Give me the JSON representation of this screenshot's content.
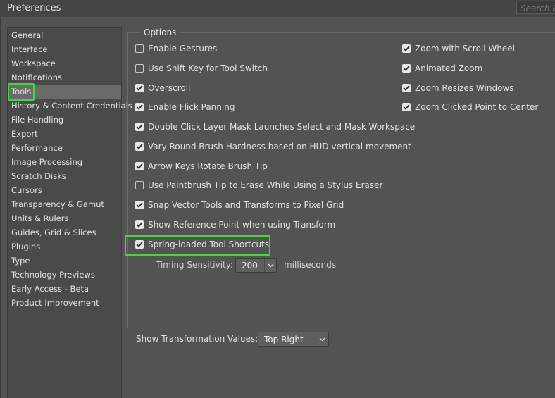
{
  "window": {
    "title": "Preferences"
  },
  "search": {
    "placeholder": "Search Preferences"
  },
  "sidebar": {
    "items": [
      {
        "label": "General",
        "selected": false
      },
      {
        "label": "Interface",
        "selected": false
      },
      {
        "label": "Workspace",
        "selected": false
      },
      {
        "label": "Notifications",
        "selected": false
      },
      {
        "label": "Tools",
        "selected": true
      },
      {
        "label": "History & Content Credentials",
        "selected": false
      },
      {
        "label": "File Handling",
        "selected": false
      },
      {
        "label": "Export",
        "selected": false
      },
      {
        "label": "Performance",
        "selected": false
      },
      {
        "label": "Image Processing",
        "selected": false
      },
      {
        "label": "Scratch Disks",
        "selected": false
      },
      {
        "label": "Cursors",
        "selected": false
      },
      {
        "label": "Transparency & Gamut",
        "selected": false
      },
      {
        "label": "Units & Rulers",
        "selected": false
      },
      {
        "label": "Guides, Grid & Slices",
        "selected": false
      },
      {
        "label": "Plugins",
        "selected": false
      },
      {
        "label": "Type",
        "selected": false
      },
      {
        "label": "Technology Previews",
        "selected": false
      },
      {
        "label": "Early Access - Beta",
        "selected": false
      },
      {
        "label": "Product Improvement",
        "selected": false
      }
    ]
  },
  "options": {
    "title": "Options",
    "left": [
      {
        "label": "Enable Gestures",
        "checked": false
      },
      {
        "label": "Use Shift Key for Tool Switch",
        "checked": false
      },
      {
        "label": "Overscroll",
        "checked": true
      },
      {
        "label": "Enable Flick Panning",
        "checked": true
      },
      {
        "label": "Double Click Layer Mask Launches Select and Mask Workspace",
        "checked": true
      },
      {
        "label": "Vary Round Brush Hardness based on HUD vertical movement",
        "checked": true
      },
      {
        "label": "Arrow Keys Rotate Brush Tip",
        "checked": true
      },
      {
        "label": "Use Paintbrush Tip to Erase While Using a Stylus Eraser",
        "checked": false
      },
      {
        "label": "Snap Vector Tools and Transforms to Pixel Grid",
        "checked": true
      },
      {
        "label": "Show Reference Point when using Transform",
        "checked": true
      },
      {
        "label": "Spring-loaded Tool Shortcuts",
        "checked": true
      }
    ],
    "right": [
      {
        "label": "Zoom with Scroll Wheel",
        "checked": true
      },
      {
        "label": "Animated Zoom",
        "checked": true
      },
      {
        "label": "Zoom Resizes Windows",
        "checked": true
      },
      {
        "label": "Zoom Clicked Point to Center",
        "checked": true
      }
    ],
    "timing": {
      "label": "Timing Sensitivity:",
      "value": "200",
      "unit": "milliseconds"
    },
    "transform_values": {
      "label": "Show Transformation Values:",
      "value": "Top Right"
    }
  },
  "colors": {
    "highlight": "#3fd93f",
    "background": "#535353",
    "sidebar_selected": "#6a6a6a"
  }
}
